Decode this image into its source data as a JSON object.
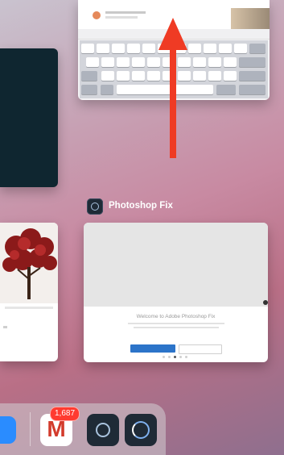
{
  "app_switcher": {
    "focused_app": {
      "name": "Photoshop Fix",
      "welcome_text": "Welcome to Adobe Photoshop Fix"
    },
    "swipe_gesture": "up"
  },
  "dock": {
    "gmail": {
      "badge": "1,687",
      "glyph": "M"
    }
  },
  "icons": [
    "files-icon",
    "gmail-icon",
    "photoshop-fix-icon",
    "photoshop-app-icon",
    "arrow-up-icon"
  ],
  "colors": {
    "arrow": "#ef3b24",
    "badge": "#ff3b30",
    "primary_button": "#2c74c9",
    "dark_card": "#0f2630"
  }
}
